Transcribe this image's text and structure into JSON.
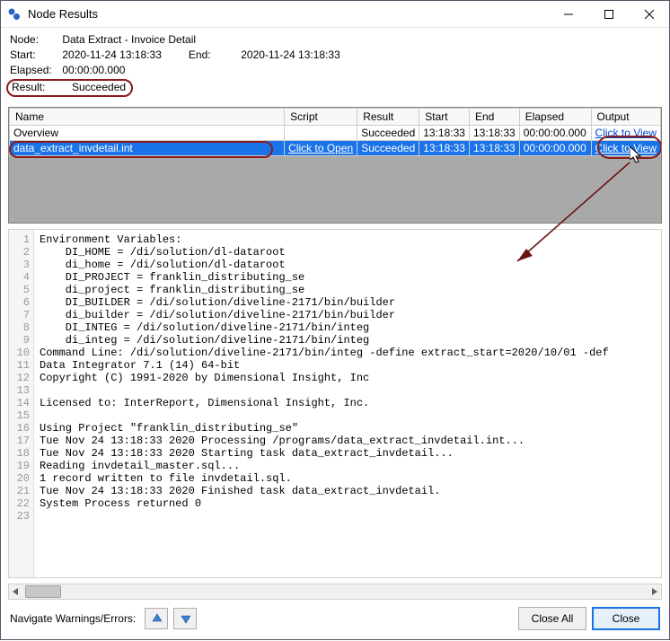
{
  "window": {
    "title": "Node Results"
  },
  "info": {
    "node_label": "Node:",
    "node_value": "Data Extract - Invoice Detail",
    "start_label": "Start:",
    "start_value": "2020-11-24 13:18:33",
    "end_label": "End:",
    "end_value": "2020-11-24 13:18:33",
    "elapsed_label": "Elapsed:",
    "elapsed_value": "00:00:00.000",
    "result_label": "Result:",
    "result_value": "Succeeded"
  },
  "table": {
    "columns": {
      "name": "Name",
      "script": "Script",
      "result": "Result",
      "start": "Start",
      "end": "End",
      "elapsed": "Elapsed",
      "output": "Output"
    },
    "rows": [
      {
        "name": "Overview",
        "script": "",
        "result": "Succeeded",
        "start": "13:18:33",
        "end": "13:18:33",
        "elapsed": "00:00:00.000",
        "output": "Click to View"
      },
      {
        "name": "data_extract_invdetail.int",
        "script": "Click to Open",
        "result": "Succeeded",
        "start": "13:18:33",
        "end": "13:18:33",
        "elapsed": "00:00:00.000",
        "output": "Click to View"
      }
    ]
  },
  "log": {
    "lines": [
      "Environment Variables:",
      "    DI_HOME = /di/solution/dl-dataroot",
      "    di_home = /di/solution/dl-dataroot",
      "    DI_PROJECT = franklin_distributing_se",
      "    di_project = franklin_distributing_se",
      "    DI_BUILDER = /di/solution/diveline-2171/bin/builder",
      "    di_builder = /di/solution/diveline-2171/bin/builder",
      "    DI_INTEG = /di/solution/diveline-2171/bin/integ",
      "    di_integ = /di/solution/diveline-2171/bin/integ",
      "Command Line: /di/solution/diveline-2171/bin/integ -define extract_start=2020/10/01 -def",
      "Data Integrator 7.1 (14) 64-bit",
      "Copyright (C) 1991-2020 by Dimensional Insight, Inc",
      "",
      "Licensed to: InterReport, Dimensional Insight, Inc.",
      "",
      "Using Project \"franklin_distributing_se\"",
      "Tue Nov 24 13:18:33 2020 Processing /programs/data_extract_invdetail.int...",
      "Tue Nov 24 13:18:33 2020 Starting task data_extract_invdetail...",
      "Reading invdetail_master.sql...",
      "1 record written to file invdetail.sql.",
      "Tue Nov 24 13:18:33 2020 Finished task data_extract_invdetail.",
      "System Process returned 0",
      ""
    ]
  },
  "footer": {
    "nav_label": "Navigate Warnings/Errors:",
    "close_all": "Close All",
    "close": "Close"
  }
}
